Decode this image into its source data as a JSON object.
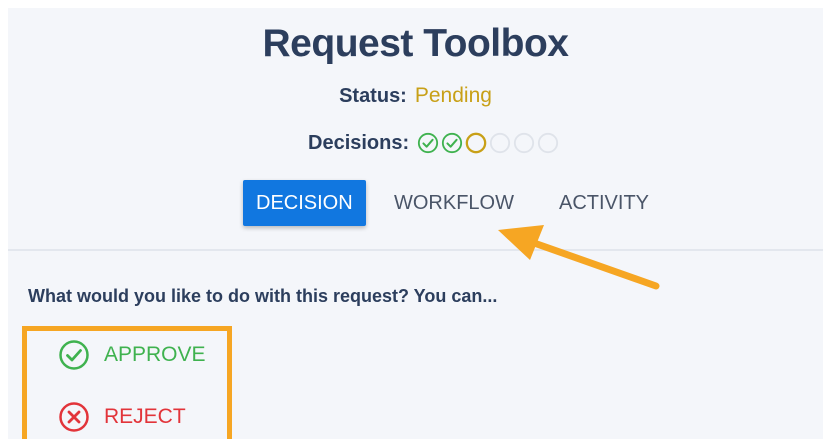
{
  "header": {
    "title": "Request Toolbox",
    "status_label": "Status:",
    "status_value": "Pending",
    "decisions_label": "Decisions:",
    "decisions": [
      {
        "state": "approved"
      },
      {
        "state": "approved"
      },
      {
        "state": "pending"
      },
      {
        "state": "empty"
      },
      {
        "state": "empty"
      },
      {
        "state": "empty"
      }
    ]
  },
  "tabs": [
    {
      "label": "DECISION",
      "active": true
    },
    {
      "label": "WORKFLOW",
      "active": false
    },
    {
      "label": "ACTIVITY",
      "active": false
    }
  ],
  "decision_panel": {
    "prompt": "What would you like to do with this request? You can...",
    "actions": [
      {
        "label": "APPROVE",
        "icon": "check-circle-icon",
        "color": "#3fb24f"
      },
      {
        "label": "REJECT",
        "icon": "x-circle-icon",
        "color": "#e2343a"
      }
    ]
  },
  "colors": {
    "title": "#2c3e5d",
    "pending": "#c8a017",
    "active_tab": "#1177e0",
    "approved": "#3fb24f",
    "rejected": "#e2343a",
    "annotation": "#f6a623"
  }
}
